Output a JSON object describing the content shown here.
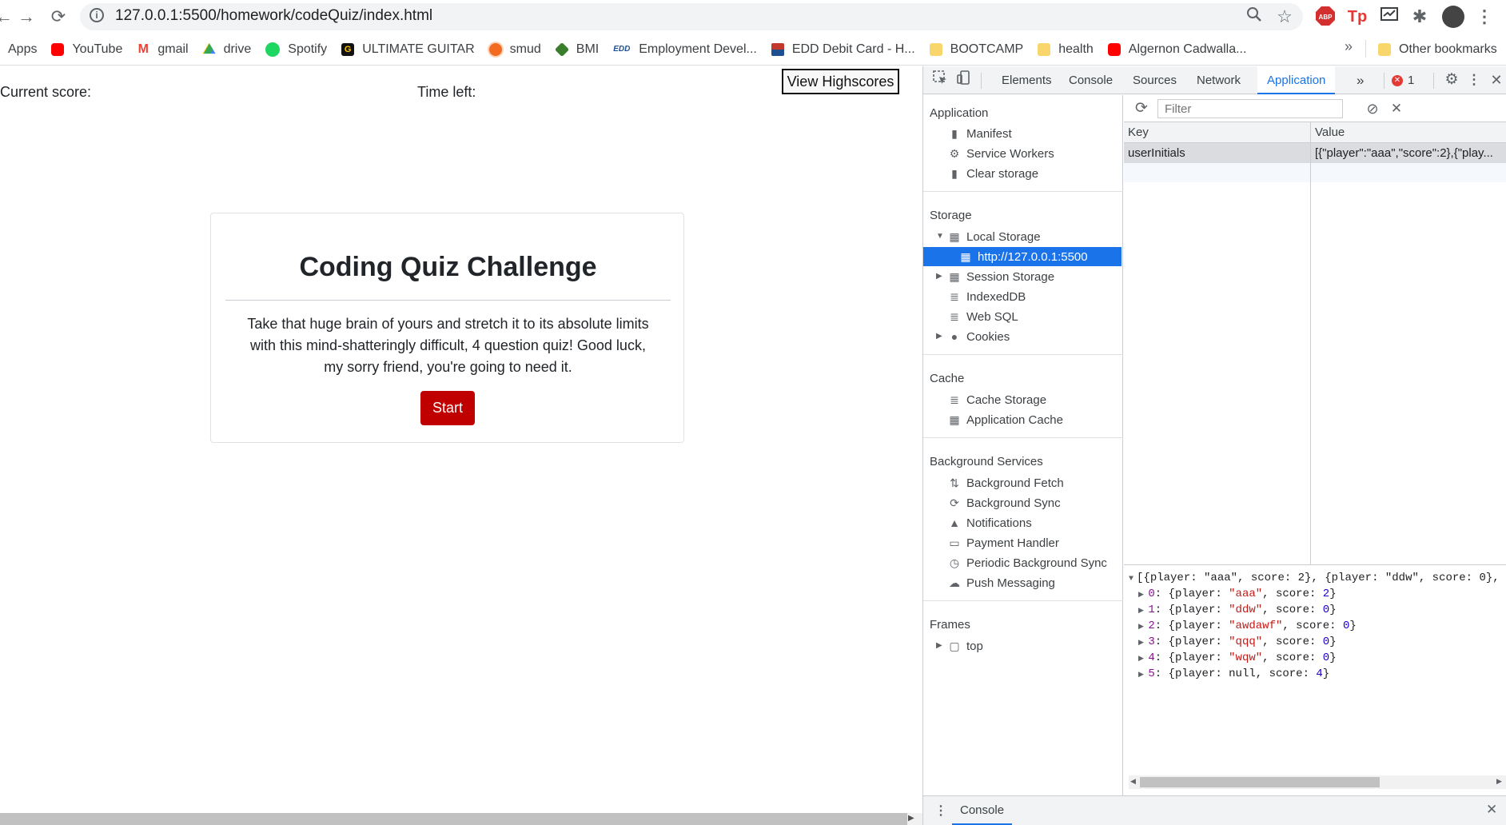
{
  "browser": {
    "url": "127.0.0.1:5500/homework/codeQuiz/index.html",
    "bookmarks": [
      {
        "label": "Apps",
        "icon": "apps-grid-icon",
        "color": "#ea4335"
      },
      {
        "label": "YouTube",
        "icon": "youtube-icon",
        "color": "#ff0000"
      },
      {
        "label": "gmail",
        "icon": "gmail-icon",
        "color": "#ea4335"
      },
      {
        "label": "drive",
        "icon": "google-drive-icon",
        "color": "#34a853"
      },
      {
        "label": "Spotify",
        "icon": "spotify-icon",
        "color": "#1ed760"
      },
      {
        "label": "ULTIMATE GUITAR",
        "icon": "ultimate-guitar-icon",
        "color": "#111111"
      },
      {
        "label": "smud",
        "icon": "smud-icon",
        "color": "#f26b21"
      },
      {
        "label": "BMI",
        "icon": "bmi-icon",
        "color": "#3a7d2c"
      },
      {
        "label": "Employment Devel...",
        "icon": "edd-icon",
        "color": "#1d4f91"
      },
      {
        "label": "EDD Debit Card - H...",
        "icon": "edd-card-icon",
        "color": "#c0392b"
      },
      {
        "label": "BOOTCAMP",
        "icon": "folder-icon",
        "color": "#f9d66b"
      },
      {
        "label": "health",
        "icon": "folder-icon",
        "color": "#f9d66b"
      },
      {
        "label": "Algernon Cadwalla...",
        "icon": "youtube-icon",
        "color": "#ff0000"
      }
    ],
    "overflow_label": "»",
    "other_bookmarks": "Other bookmarks"
  },
  "page": {
    "current_score_label": "Current score:",
    "time_left_label": "Time left:",
    "view_highscores": "View Highscores",
    "card": {
      "title": "Coding Quiz Challenge",
      "body": "Take that huge brain of yours and stretch it to its absolute limits with this mind-shatteringly difficult, 4 question quiz! Good luck, my sorry friend, you're going to need it.",
      "start": "Start"
    }
  },
  "devtools": {
    "tabs": [
      "Elements",
      "Console",
      "Sources",
      "Network",
      "Application"
    ],
    "active_tab": "Application",
    "more_tabs": "»",
    "error_count": "1",
    "sidebar": {
      "application": {
        "title": "Application",
        "items": [
          "Manifest",
          "Service Workers",
          "Clear storage"
        ]
      },
      "storage": {
        "title": "Storage",
        "local_storage": "Local Storage",
        "local_origin": "http://127.0.0.1:5500",
        "items": [
          "Session Storage",
          "IndexedDB",
          "Web SQL",
          "Cookies"
        ]
      },
      "cache": {
        "title": "Cache",
        "items": [
          "Cache Storage",
          "Application Cache"
        ]
      },
      "background": {
        "title": "Background Services",
        "items": [
          "Background Fetch",
          "Background Sync",
          "Notifications",
          "Payment Handler",
          "Periodic Background Sync",
          "Push Messaging"
        ]
      },
      "frames": {
        "title": "Frames",
        "items": [
          "top"
        ]
      }
    },
    "filter_placeholder": "Filter",
    "table": {
      "key_header": "Key",
      "value_header": "Value",
      "row": {
        "key": "userInitials",
        "value": "[{\"player\":\"aaa\",\"score\":2},{\"play..."
      }
    },
    "preview": {
      "summary": "[{player: \"aaa\", score: 2}, {player: \"ddw\", score: 0}, {",
      "entries": [
        {
          "index": "0",
          "player": "\"aaa\"",
          "score": "2"
        },
        {
          "index": "1",
          "player": "\"ddw\"",
          "score": "0"
        },
        {
          "index": "2",
          "player": "\"awdawf\"",
          "score": "0"
        },
        {
          "index": "3",
          "player": "\"qqq\"",
          "score": "0"
        },
        {
          "index": "4",
          "player": "\"wqw\"",
          "score": "0"
        },
        {
          "index": "5",
          "player": "null",
          "score": "4"
        }
      ]
    },
    "drawer": {
      "tab": "Console"
    }
  }
}
